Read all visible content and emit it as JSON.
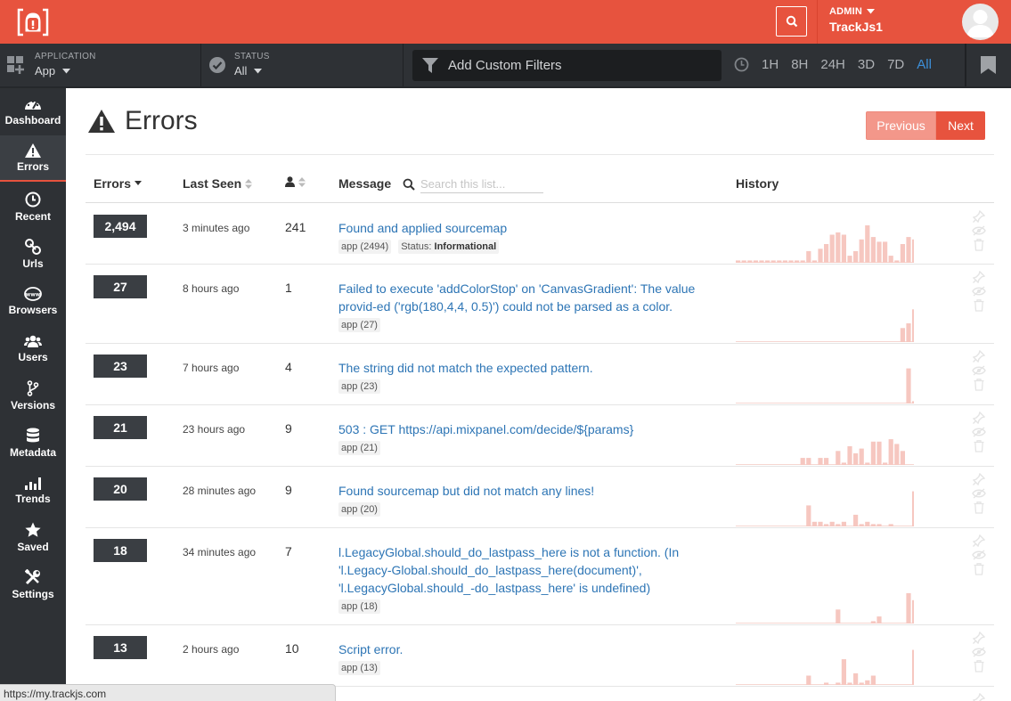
{
  "header": {
    "admin_label": "ADMIN",
    "account_name": "TrackJs1"
  },
  "filters": {
    "application_label": "APPLICATION",
    "application_value": "App",
    "status_label": "STATUS",
    "status_value": "All",
    "custom_filter_label": "Add Custom Filters",
    "time_ranges": [
      "1H",
      "8H",
      "24H",
      "3D",
      "7D",
      "All"
    ],
    "active_time_range": "All"
  },
  "sidebar": {
    "items": [
      {
        "label": "Dashboard",
        "icon": "dashboard-icon"
      },
      {
        "label": "Errors",
        "icon": "warning-icon"
      },
      {
        "label": "Recent",
        "icon": "clock-icon"
      },
      {
        "label": "Urls",
        "icon": "link-icon"
      },
      {
        "label": "Browsers",
        "icon": "globe-icon"
      },
      {
        "label": "Users",
        "icon": "users-icon"
      },
      {
        "label": "Versions",
        "icon": "branch-icon"
      },
      {
        "label": "Metadata",
        "icon": "database-icon"
      },
      {
        "label": "Trends",
        "icon": "bars-icon"
      },
      {
        "label": "Saved",
        "icon": "star-icon"
      },
      {
        "label": "Settings",
        "icon": "tools-icon"
      }
    ],
    "active": "Errors"
  },
  "page": {
    "title": "Errors",
    "previous_label": "Previous",
    "next_label": "Next"
  },
  "table": {
    "columns": {
      "errors": "Errors",
      "last_seen": "Last Seen",
      "message": "Message",
      "history": "History"
    },
    "search_placeholder": "Search this list...",
    "rows": [
      {
        "count": "2,494",
        "last_seen": "3 minutes ago",
        "users": "241",
        "message": "Found and applied sourcemap",
        "app_tag": "app (2494)",
        "status_label": "Status:",
        "status_value": "Informational",
        "history": [
          1,
          1,
          1,
          1,
          1,
          1,
          1,
          1,
          1,
          1,
          1,
          1,
          5,
          1,
          6,
          8,
          12,
          13,
          12,
          3,
          5,
          10,
          16,
          11,
          9,
          9,
          3,
          1,
          8,
          11,
          10
        ]
      },
      {
        "count": "27",
        "last_seen": "8 hours ago",
        "users": "1",
        "message": "Failed to execute 'addColorStop' on 'CanvasGradient': The value provid-ed ('rgb(180,4,4, 0.5)') could not be parsed as a color.",
        "app_tag": "app (27)",
        "history": [
          0,
          0,
          0,
          0,
          0,
          0,
          0,
          0,
          0,
          0,
          0,
          0,
          0,
          0,
          0,
          0,
          0,
          0,
          0,
          0,
          0,
          0,
          0,
          0,
          0,
          0,
          0,
          0,
          6,
          8,
          14
        ]
      },
      {
        "count": "23",
        "last_seen": "7 hours ago",
        "users": "4",
        "message": "The string did not match the expected pattern.",
        "app_tag": "app (23)",
        "history": [
          0,
          0,
          0,
          0,
          0,
          0,
          0,
          0,
          0,
          0,
          0,
          0,
          0,
          0,
          0,
          0,
          0,
          0,
          0,
          0,
          0,
          0,
          0,
          0,
          0,
          0,
          0,
          0,
          0,
          15,
          1
        ]
      },
      {
        "count": "21",
        "last_seen": "23 hours ago",
        "users": "9",
        "message": "503 : GET https://api.mixpanel.com/decide/${params}",
        "app_tag": "app (21)",
        "history": [
          0,
          0,
          0,
          0,
          0,
          0,
          0,
          0,
          0,
          0,
          0,
          3,
          3,
          0,
          3,
          3,
          0,
          6,
          1,
          8,
          5,
          7,
          1,
          10,
          10,
          1,
          11,
          9,
          6,
          0,
          0
        ]
      },
      {
        "count": "20",
        "last_seen": "28 minutes ago",
        "users": "9",
        "message": "Found sourcemap but did not match any lines!",
        "app_tag": "app (20)",
        "history": [
          0,
          0,
          0,
          0,
          0,
          0,
          0,
          0,
          0,
          0,
          0,
          0,
          9,
          2,
          2,
          1,
          2,
          1,
          2,
          0,
          5,
          1,
          2,
          1,
          1,
          0,
          1,
          0,
          0,
          0,
          15
        ]
      },
      {
        "count": "18",
        "last_seen": "34 minutes ago",
        "users": "7",
        "message": "l.LegacyGlobal.should_do_lastpass_here is not a function. (In 'l.Legacy-Global.should_do_lastpass_here(document)', 'l.LegacyGlobal.should_-do_lastpass_here' is undefined)",
        "app_tag": "app (18)",
        "history": [
          0,
          0,
          0,
          0,
          0,
          0,
          0,
          0,
          0,
          0,
          0,
          0,
          0,
          0,
          0,
          0,
          0,
          6,
          0,
          0,
          0,
          0,
          0,
          1,
          3,
          0,
          0,
          0,
          0,
          13,
          10
        ]
      },
      {
        "count": "13",
        "last_seen": "2 hours ago",
        "users": "10",
        "message": "Script error.",
        "app_tag": "app (13)",
        "history": [
          0,
          0,
          0,
          0,
          0,
          0,
          0,
          0,
          0,
          0,
          0,
          0,
          4,
          0,
          0,
          1,
          0,
          1,
          11,
          1,
          5,
          1,
          2,
          4,
          0,
          0,
          0,
          0,
          0,
          0,
          15
        ]
      }
    ]
  },
  "status_bar": {
    "url": "https://my.trackjs.com"
  },
  "colors": {
    "brand": "#e7533e",
    "sidebar": "#2e3135",
    "link": "#2d75b5",
    "history_bar": "#f6c7c0",
    "active_time": "#3d8fd8"
  }
}
